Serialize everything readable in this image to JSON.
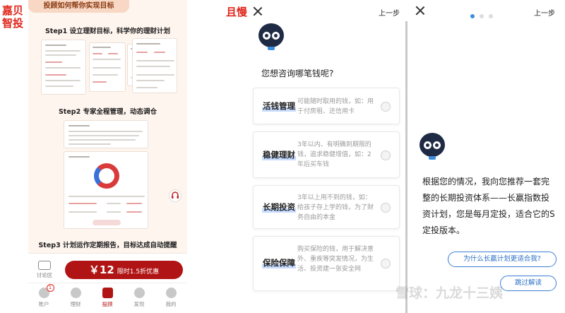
{
  "panel1": {
    "tag": "嘉贝智投",
    "banner": "投顾如何帮你实现目标",
    "step1": "Step1  设立理财目标，科学你的理财计划",
    "step2": "Step2  专家全程管理，动态调仓",
    "step3": "Step3  计划运作定期报告，目标达成自动提醒",
    "forum_label": "讨论区",
    "price": "￥12",
    "price_note": "限时1.5折优惠",
    "tabs": [
      {
        "label": "账户",
        "badge": "1"
      },
      {
        "label": "理财"
      },
      {
        "label": "投顾"
      },
      {
        "label": "发现"
      },
      {
        "label": "我的"
      }
    ],
    "active_tab": "投顾",
    "accent_color": "#b01414"
  },
  "panel2": {
    "tag": "且慢",
    "prev_step": "上一步",
    "question": "您想咨询哪笔钱呢?",
    "options": [
      {
        "title": "活钱管理",
        "desc": "可能随时取用的钱，如：用于付房租、还信用卡"
      },
      {
        "title": "稳健理财",
        "desc": "3年以内、有明确到期限的钱，追求稳健增值，如：2年后买车钱"
      },
      {
        "title": "长期投资",
        "desc": "3年以上用不到的钱，如：给孩子存上学的钱，为了财务自由的本金"
      },
      {
        "title": "保险保障",
        "desc": "购买保险的钱，用于解决意外、重疾等突发情况，为生活、投资建一张安全网"
      }
    ]
  },
  "panel3": {
    "prev_step": "上一步",
    "message": "根据您的情况，我向您推荐一套完整的长期投资体系——长赢指数投资计划，您是每月定投，适合它的S定投版本。",
    "btn_why": "为什么长赢计划更适合我?",
    "btn_skip": "跳过解读",
    "accent_color": "#3a8dde"
  },
  "watermark": "雪球：九龙十三姨"
}
